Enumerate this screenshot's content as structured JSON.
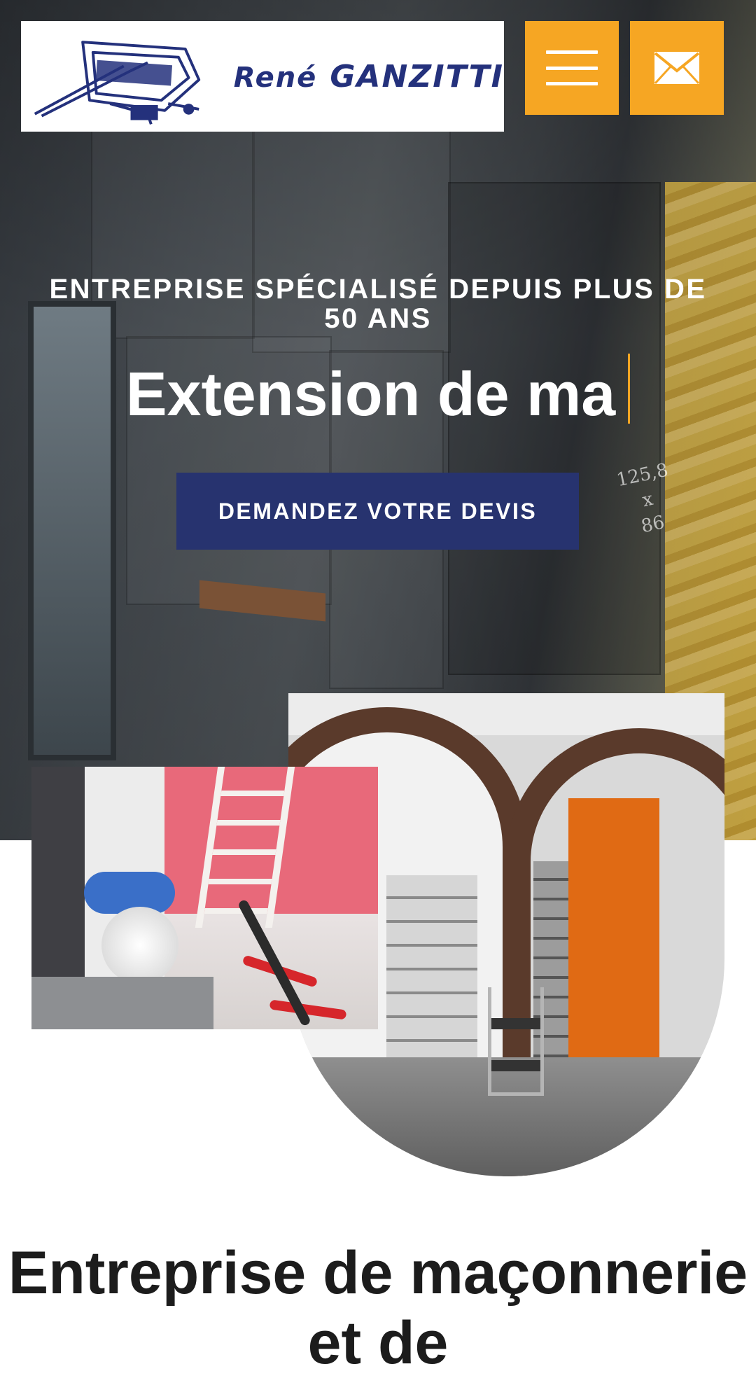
{
  "header": {
    "logo": {
      "first_name": "René",
      "last_name": "GANZITTI"
    },
    "menu_icon": "hamburger-icon",
    "mail_icon": "envelope-icon",
    "accent_color": "#f6a623"
  },
  "hero": {
    "tagline": "ENTREPRISE SPÉCIALISÉ DEPUIS PLUS DE 50 ANS",
    "headline": "Extension de ma",
    "cta_label": "DEMANDEZ VOTRE DEVIS",
    "cta_color": "#27336f",
    "wall_marking": [
      "125,8",
      "x",
      "86"
    ]
  },
  "section": {
    "title": "Entreprise de maçonnerie et de"
  }
}
